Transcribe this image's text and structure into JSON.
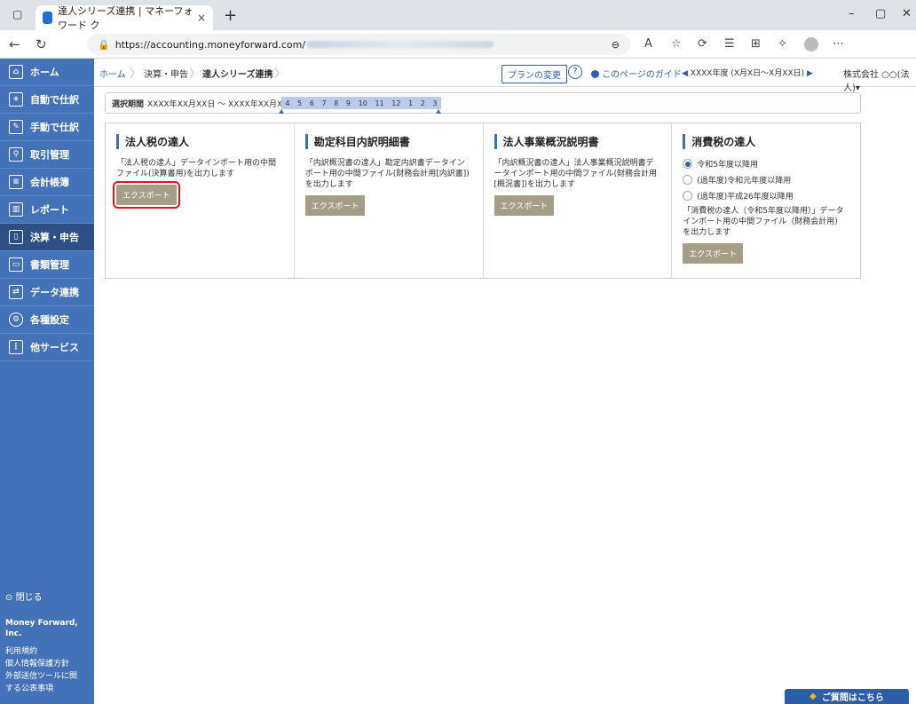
{
  "browser": {
    "tab_title": "達人シリーズ連携 | マネーフォワード ク",
    "tab_close": "×",
    "new_tab": "+",
    "url_prefix": "https://accounting.moneyforward.com/"
  },
  "sidebar": {
    "items": [
      {
        "label": "ホーム",
        "icon": "home-icon"
      },
      {
        "label": "自動で仕訳",
        "icon": "auto-journal-icon"
      },
      {
        "label": "手動で仕訳",
        "icon": "manual-journal-icon"
      },
      {
        "label": "取引管理",
        "icon": "transactions-icon"
      },
      {
        "label": "会計帳簿",
        "icon": "ledger-icon"
      },
      {
        "label": "レポート",
        "icon": "report-icon"
      },
      {
        "label": "決算・申告",
        "icon": "settlement-icon"
      },
      {
        "label": "書類管理",
        "icon": "folder-icon"
      },
      {
        "label": "データ連携",
        "icon": "data-link-icon"
      },
      {
        "label": "各種設定",
        "icon": "gear-icon"
      },
      {
        "label": "他サービス",
        "icon": "list-icon"
      }
    ],
    "close": "閉じる",
    "company": "Money Forward, Inc.",
    "links": [
      "利用規約",
      "個人情報保護方針",
      "外部送信ツールに関",
      "する公表事項"
    ]
  },
  "breadcrumb": {
    "home": "ホーム",
    "settle": "決算・申告",
    "current": "達人シリーズ連携"
  },
  "topbar": {
    "plan": "プランの変更",
    "help": "?",
    "guide": "このページのガイド",
    "period": "XXXX年度 (X月X日～X月XX日)",
    "company": "株式会社 ○○(法人)"
  },
  "period": {
    "label": "選択期間",
    "range": "XXXX年XX月XX日 ～ XXXX年XX月XX日",
    "months": [
      "4",
      "5",
      "6",
      "7",
      "8",
      "9",
      "10",
      "11",
      "12",
      "1",
      "2",
      "3"
    ]
  },
  "cards": [
    {
      "title": "法人税の達人",
      "desc": "「法人税の達人」データインポート用の中間ファイル(決算書用)を出力します",
      "button": "エクスポート"
    },
    {
      "title": "勘定科目内訳明細書",
      "desc": "「内訳概況書の達人」勘定内訳書データインポート用の中間ファイル(財務会計用[内訳書])を出力します",
      "button": "エクスポート"
    },
    {
      "title": "法人事業概況説明書",
      "desc": "「内訳概況書の達人」法人事業概況説明書データインポート用の中間ファイル(財務会計用[概況書])を出力します",
      "button": "エクスポート"
    },
    {
      "title": "消費税の達人",
      "radios": [
        "令和5年度以降用",
        "(過年度)令和元年度以降用",
        "(過年度)平成26年度以降用"
      ],
      "desc": "「消費税の達人（令和5年度以降用）」データインポート用の中間ファイル（財務会計用）を出力します",
      "button": "エクスポート"
    }
  ],
  "ask": "ご質問はこちら"
}
